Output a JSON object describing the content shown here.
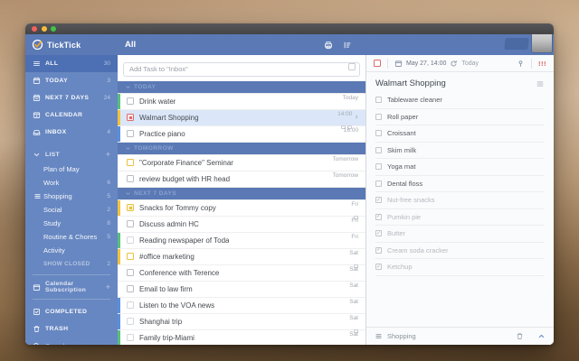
{
  "colors": {
    "header_blue": "#5a79b5",
    "sidebar_blue": "#6787c2",
    "sidebar_selected": "#4d6fb3",
    "selection_row": "#dbe7f8",
    "priority_red": "#e05f5f",
    "list_yellow": "#f2c23e",
    "list_green": "#57c07d",
    "list_blue": "#5b8edc"
  },
  "header": {
    "app_name": "TickTick",
    "view_title": "All"
  },
  "sidebar": {
    "rows": [
      {
        "type": "smart",
        "icon": "all",
        "label": "ALL",
        "count": "30",
        "selected": true
      },
      {
        "type": "smart",
        "icon": "today",
        "label": "TODAY",
        "count": "3"
      },
      {
        "type": "smart",
        "icon": "next7",
        "label": "NEXT 7 DAYS",
        "count": "24"
      },
      {
        "type": "smart",
        "icon": "cal",
        "label": "CALENDAR",
        "count": ""
      },
      {
        "type": "smart",
        "icon": "inbox",
        "label": "INBOX",
        "count": "4"
      },
      {
        "type": "spacer"
      },
      {
        "type": "section",
        "icon": "chevdown",
        "label": "LIST",
        "count": "+"
      },
      {
        "type": "litem",
        "label": "Plan of May",
        "count": ""
      },
      {
        "type": "litem",
        "label": "Work",
        "count": "6"
      },
      {
        "type": "litem",
        "icon": "listsmall",
        "label": "Shopping",
        "count": "5"
      },
      {
        "type": "litem",
        "label": "Social",
        "count": "2"
      },
      {
        "type": "litem",
        "label": "Study",
        "count": "8"
      },
      {
        "type": "litem",
        "label": "Routine & Chores",
        "count": "5"
      },
      {
        "type": "litem",
        "label": "Activity",
        "count": ""
      },
      {
        "type": "litem",
        "muted": true,
        "label": "SHOW CLOSED",
        "count": "2"
      },
      {
        "type": "divider"
      },
      {
        "type": "section",
        "icon": "calsub",
        "label": "Calendar Subscription",
        "count": "+"
      },
      {
        "type": "divider"
      },
      {
        "type": "smart",
        "icon": "completed",
        "label": "COMPLETED",
        "count": ""
      },
      {
        "type": "smart",
        "icon": "trash",
        "label": "TRASH",
        "count": ""
      },
      {
        "type": "search",
        "icon": "search",
        "label": "Search",
        "count": ""
      }
    ]
  },
  "tasklist": {
    "add_task_placeholder": "Add Task to \"Inbox\"",
    "rows": [
      {
        "type": "header",
        "label": "TODAY"
      },
      {
        "type": "task",
        "title": "Drink water",
        "due": "Today",
        "strip": "green",
        "checkbox": "gray"
      },
      {
        "type": "task",
        "title": "Walmart Shopping",
        "due": "14:00",
        "strip": "yellow",
        "checkbox": "red",
        "selected": true,
        "sub_icons": 2
      },
      {
        "type": "task",
        "title": "Practice piano",
        "due": "16:00",
        "strip": "blue",
        "checkbox": "gray"
      },
      {
        "type": "header",
        "label": "TOMORROW"
      },
      {
        "type": "task",
        "title": "\"Corporate Finance\" Seminar",
        "due": "Tomorrow",
        "checkbox": "yellow"
      },
      {
        "type": "task",
        "title": "review budget with HR head",
        "due": "Tomorrow",
        "checkbox": "gray"
      },
      {
        "type": "header",
        "label": "NEXT 7 DAYS"
      },
      {
        "type": "task",
        "title": "Snacks for Tommy copy",
        "due": "Fri",
        "strip": "yellow",
        "checkbox": "yellowfill",
        "sub_icons": 1
      },
      {
        "type": "task",
        "title": "Discuss admin HC",
        "due": "Fri",
        "checkbox": "gray"
      },
      {
        "type": "task",
        "title": "Reading newspaper of Toda",
        "due": "Fri",
        "strip": "green",
        "checkbox": "light"
      },
      {
        "type": "task",
        "title": "#office marketing",
        "due": "Sat",
        "strip": "yellow",
        "checkbox": "yellow",
        "sub_icons": 1
      },
      {
        "type": "task",
        "title": "Conference with Terence",
        "due": "Sat",
        "checkbox": "gray"
      },
      {
        "type": "task",
        "title": "Email to law firm",
        "due": "Sat",
        "checkbox": "gray"
      },
      {
        "type": "task",
        "title": "Listen to the VOA news",
        "due": "Sat",
        "strip": "blue",
        "checkbox": "light"
      },
      {
        "type": "task",
        "title": "Shanghai trip",
        "due": "Sat",
        "strip": "blue",
        "checkbox": "light",
        "sub_icons": 1
      },
      {
        "type": "task",
        "title": "Family trip-Miami",
        "due": "Sat",
        "strip": "green",
        "checkbox": "light",
        "sub_icons": 1
      }
    ]
  },
  "detail": {
    "toolbar": {
      "date": "May 27, 14:00",
      "repeat_label": "Today",
      "priority": "!!!"
    },
    "title": "Walmart Shopping",
    "checklist": [
      {
        "label": "Tableware cleaner",
        "checked": false
      },
      {
        "label": "Roll paper",
        "checked": false
      },
      {
        "label": "Croissant",
        "checked": false
      },
      {
        "label": "Skim milk",
        "checked": false
      },
      {
        "label": "Yoga mat",
        "checked": false
      },
      {
        "label": "Dental floss",
        "checked": false
      },
      {
        "label": "Nut-free snacks",
        "checked": true
      },
      {
        "label": "Pumkin pie",
        "checked": true
      },
      {
        "label": "Butter",
        "checked": true
      },
      {
        "label": "Cream soda cracker",
        "checked": true
      },
      {
        "label": "Ketchup",
        "checked": true
      }
    ],
    "footer": {
      "list_name": "Shopping"
    }
  }
}
